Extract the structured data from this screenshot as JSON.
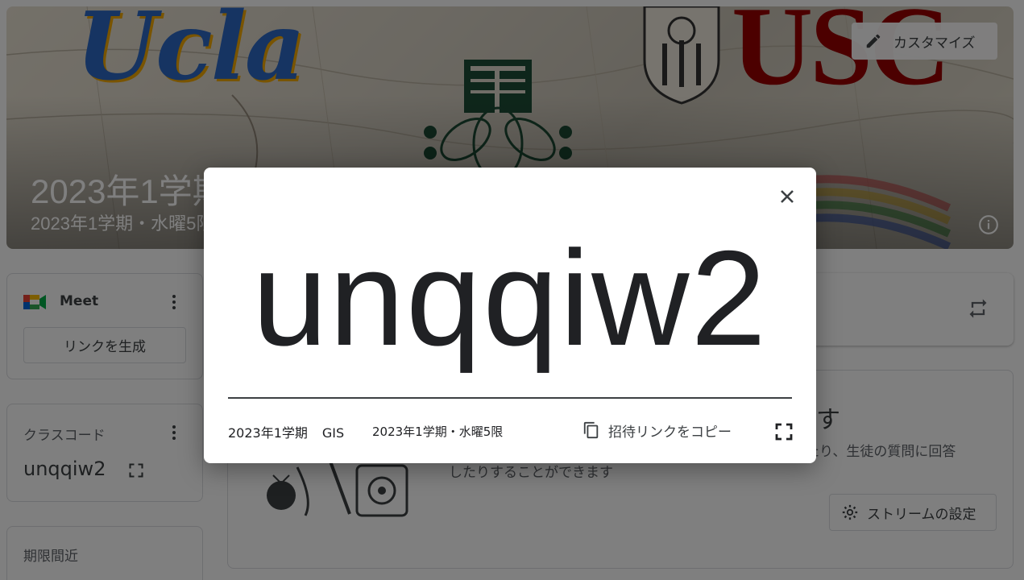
{
  "banner": {
    "title": "2023年1学期",
    "subtitle": "2023年1学期・水曜5限",
    "customize_label": "カスタマイズ",
    "logo_left_text": "Ucla",
    "logo_right_text": "USC",
    "logo_center_text": "麗"
  },
  "meet": {
    "label": "Meet",
    "generate_link_label": "リンクを生成"
  },
  "class_code_card": {
    "label": "クラスコード",
    "code": "unqqiw2"
  },
  "due_card": {
    "label": "期限間近"
  },
  "stream": {
    "heading": "ます",
    "description_line1": "したり、生徒の質問に回答",
    "description_line2": "したりすることができます",
    "settings_label": "ストリームの設定"
  },
  "dialog": {
    "code": "unqqiw2",
    "class_name": "2023年1学期",
    "class_subject": "GIS",
    "section": "2023年1学期・水曜5限",
    "copy_invite_label": "招待リンクをコピー"
  },
  "colors": {
    "ucla_blue": "#2d68c4",
    "ucla_gold": "#f2a900",
    "usc_red": "#990000",
    "overlay": "rgba(0,0,0,0.5)"
  },
  "icons": [
    "pencil-icon",
    "info-icon",
    "meet-logo-icon",
    "kebab-icon",
    "expand-icon",
    "repost-icon",
    "gear-icon",
    "close-icon",
    "copy-icon",
    "fullscreen-icon"
  ]
}
